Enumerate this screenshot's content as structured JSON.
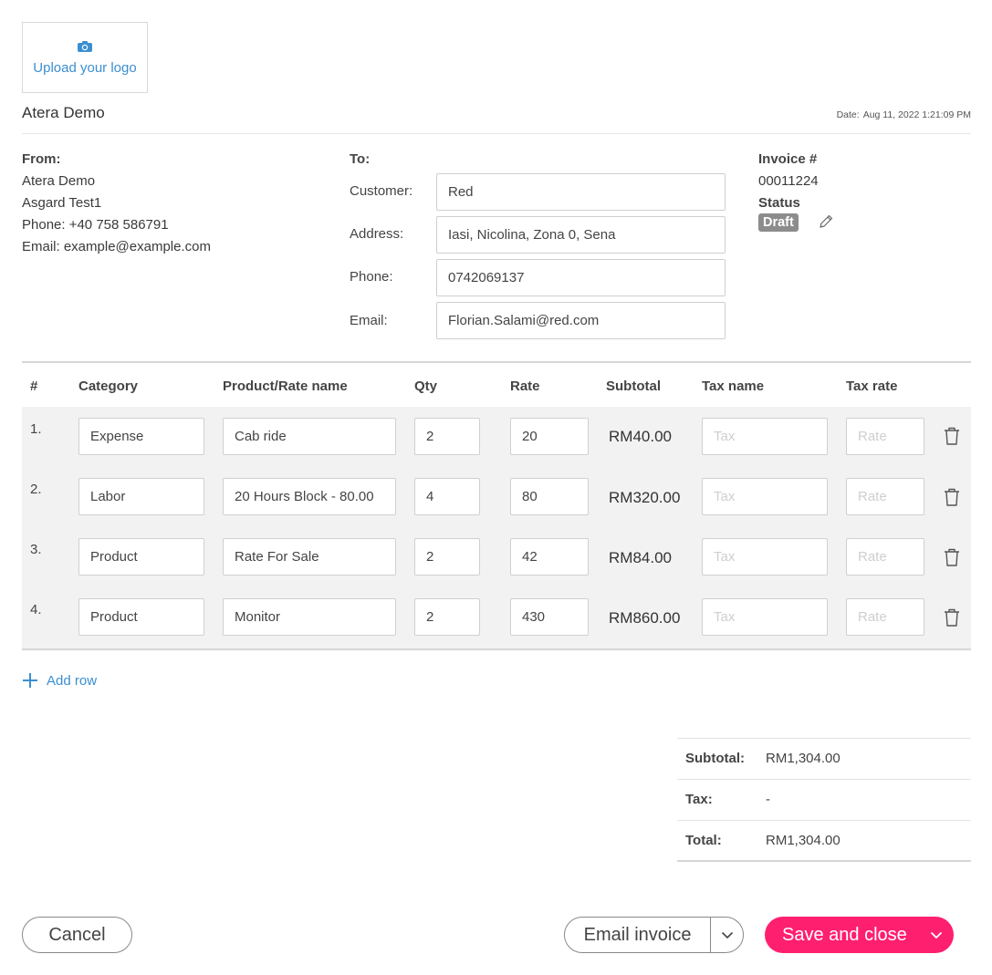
{
  "logo": {
    "upload_label": "Upload your logo",
    "icon": "camera-icon",
    "accent": "#3b8fd1"
  },
  "company": {
    "name": "Atera Demo"
  },
  "date": {
    "label": "Date:",
    "value": "Aug 11, 2022 1:21:09 PM"
  },
  "from": {
    "title": "From:",
    "lines": [
      "Atera Demo",
      "Asgard Test1",
      "Phone: +40 758 586791",
      "Email: example@example.com"
    ]
  },
  "to": {
    "title": "To:",
    "customer": {
      "label": "Customer:",
      "value": "Red"
    },
    "address": {
      "label": "Address:",
      "value": "Iasi, Nicolina, Zona 0, Sena"
    },
    "phone": {
      "label": "Phone:",
      "value": "0742069137"
    },
    "email": {
      "label": "Email:",
      "value": "Florian.Salami@red.com"
    }
  },
  "invoice": {
    "number_label": "Invoice #",
    "number": "00011224",
    "status_label": "Status",
    "status": "Draft",
    "status_color": "#8c8c8c"
  },
  "table": {
    "headers": [
      "#",
      "Category",
      "Product/Rate name",
      "Qty",
      "Rate",
      "Subtotal",
      "Tax name",
      "Tax rate"
    ],
    "tax_placeholder": "Tax",
    "rate_placeholder": "Rate",
    "rows": [
      {
        "num": "1.",
        "category": "Expense",
        "product": "Cab ride",
        "qty": "2",
        "rate": "20",
        "subtotal": "RM40.00"
      },
      {
        "num": "2.",
        "category": "Labor",
        "product": "20 Hours Block - 80.00",
        "qty": "4",
        "rate": "80",
        "subtotal": "RM320.00"
      },
      {
        "num": "3.",
        "category": "Product",
        "product": "Rate For Sale",
        "qty": "2",
        "rate": "42",
        "subtotal": "RM84.00"
      },
      {
        "num": "4.",
        "category": "Product",
        "product": "Monitor",
        "qty": "2",
        "rate": "430",
        "subtotal": "RM860.00"
      }
    ]
  },
  "add_row": {
    "label": "Add row"
  },
  "totals": {
    "subtotal_label": "Subtotal:",
    "subtotal": "RM1,304.00",
    "tax_label": "Tax:",
    "tax": "-",
    "total_label": "Total:",
    "total": "RM1,304.00"
  },
  "buttons": {
    "cancel": "Cancel",
    "email_invoice": "Email invoice",
    "save_close": "Save and close",
    "save_color": "#ff1f6f"
  }
}
